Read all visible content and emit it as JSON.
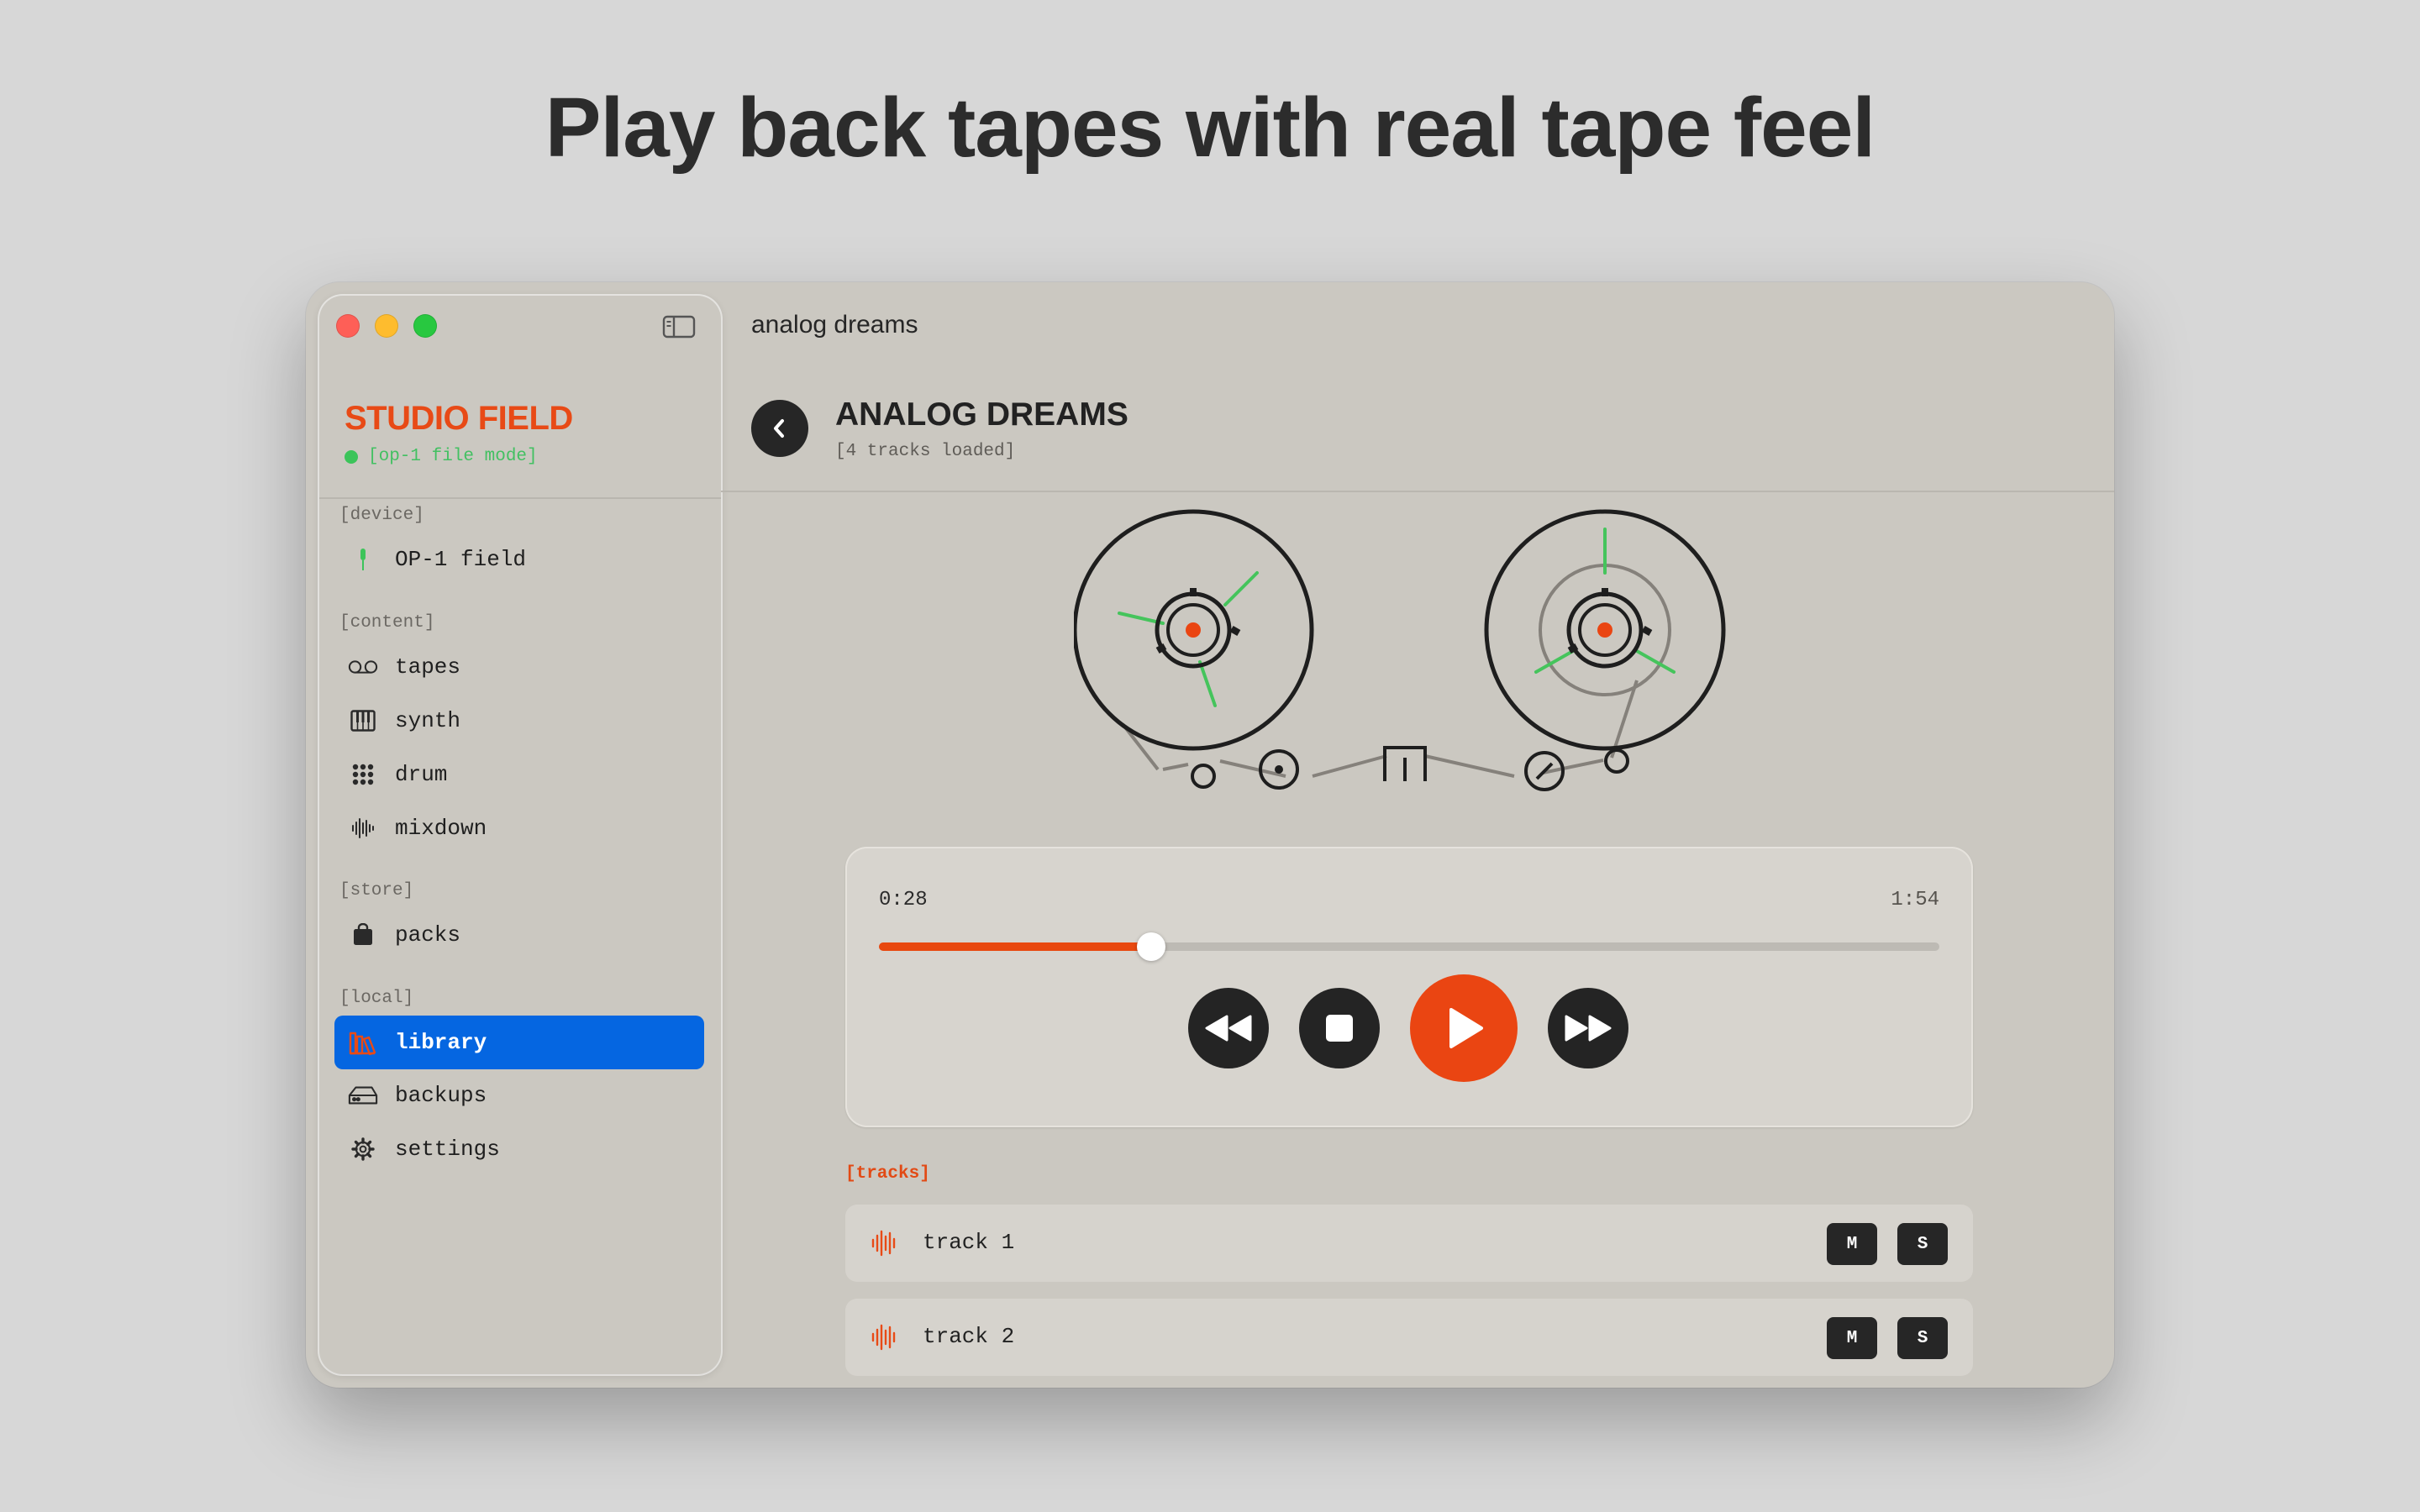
{
  "headline": "Play back tapes with real tape feel",
  "sidebar": {
    "brand": "STUDIO FIELD",
    "status": "[op-1 file mode]",
    "sections": [
      {
        "label": "[device]",
        "items": [
          {
            "label": "OP-1 field",
            "icon": "op1-device-icon"
          }
        ]
      },
      {
        "label": "[content]",
        "items": [
          {
            "label": "tapes",
            "icon": "tape-icon"
          },
          {
            "label": "synth",
            "icon": "piano-keys-icon"
          },
          {
            "label": "drum",
            "icon": "drum-grid-icon"
          },
          {
            "label": "mixdown",
            "icon": "waveform-icon"
          }
        ]
      },
      {
        "label": "[store]",
        "items": [
          {
            "label": "packs",
            "icon": "bag-icon"
          }
        ]
      },
      {
        "label": "[local]",
        "items": [
          {
            "label": "library",
            "icon": "library-icon",
            "active": true
          },
          {
            "label": "backups",
            "icon": "drive-icon"
          },
          {
            "label": "settings",
            "icon": "gear-icon"
          }
        ]
      }
    ]
  },
  "main": {
    "window_title": "analog dreams",
    "album_title": "ANALOG DREAMS",
    "album_subtitle": "[4 tracks loaded]",
    "player": {
      "current_time": "0:28",
      "total_time": "1:54",
      "progress": 0.257
    },
    "tracks_label": "[tracks]",
    "tracks": [
      {
        "name": "track 1",
        "mute_label": "M",
        "solo_label": "S"
      },
      {
        "name": "track 2",
        "mute_label": "M",
        "solo_label": "S"
      }
    ]
  },
  "colors": {
    "accent": "#e84a16",
    "active_nav": "#0566e1",
    "reel_spoke": "#45c45c",
    "status_green": "#43c062"
  }
}
